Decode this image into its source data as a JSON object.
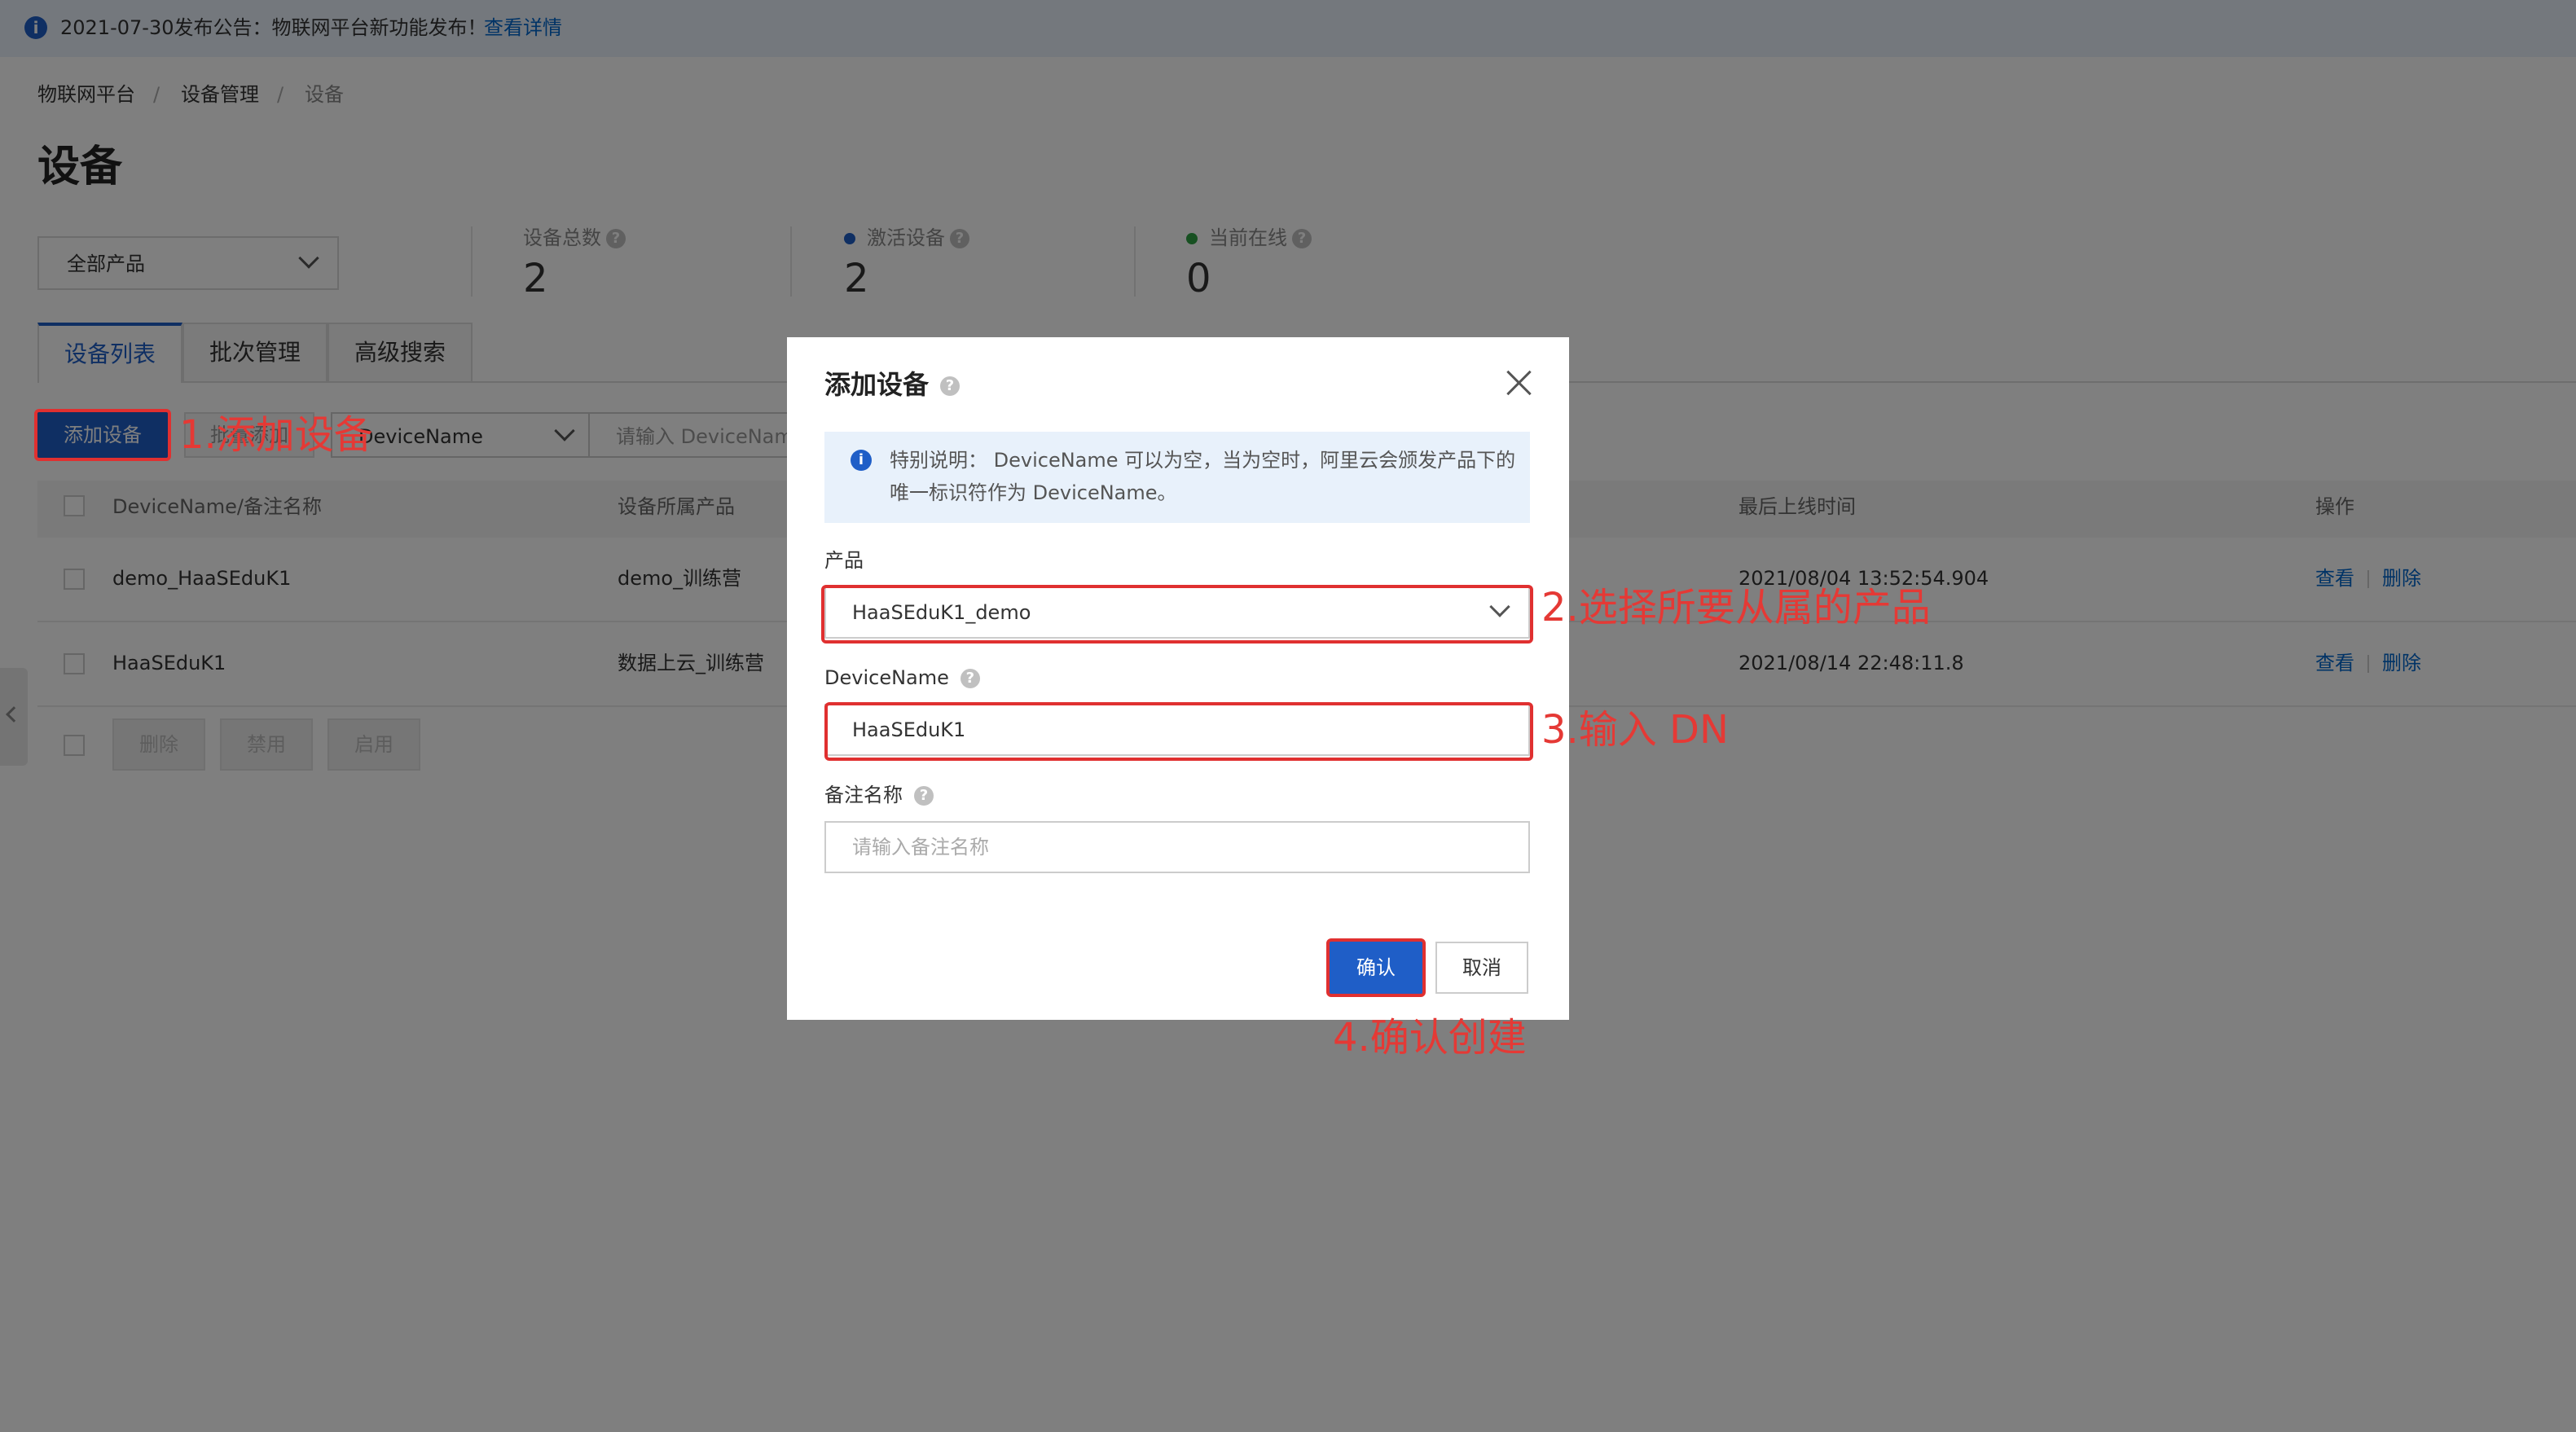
{
  "announcement": {
    "text": "2021-07-30发布公告：物联网平台新功能发布！",
    "link": "查看详情"
  },
  "breadcrumb": [
    "物联网平台",
    "设备管理",
    "设备"
  ],
  "breadcrumb_sep": "/",
  "page_title": "设备",
  "product_filter": "全部产品",
  "stats": [
    {
      "label": "设备总数",
      "value": "2"
    },
    {
      "label": "激活设备",
      "value": "2",
      "dot_color": "#1f5ec7"
    },
    {
      "label": "当前在线",
      "value": "0",
      "dot_color": "#2ea043"
    }
  ],
  "tabs": [
    "设备列表",
    "批次管理",
    "高级搜索"
  ],
  "toolbar": {
    "add_device": "添加设备",
    "batch_add": "批量添加",
    "search_field": "DeviceName",
    "search_placeholder": "请输入 DeviceName"
  },
  "table": {
    "headers": [
      "DeviceName/备注名称",
      "设备所属产品",
      "最后上线时间",
      "操作"
    ],
    "rows": [
      {
        "name": "demo_HaaSEduK1",
        "product": "demo_训练营",
        "last_online": "2021/08/04 13:52:54.904",
        "view": "查看",
        "delete": "删除"
      },
      {
        "name": "HaaSEduK1",
        "product": "数据上云_训练营",
        "last_online": "2021/08/14 22:48:11.8",
        "view": "查看",
        "delete": "删除"
      }
    ],
    "bulk_actions": [
      "删除",
      "禁用",
      "启用"
    ]
  },
  "modal": {
    "title": "添加设备",
    "notice_line1": "特别说明： DeviceName 可以为空，当为空时，阿里云会颁发产品下的",
    "notice_line2": "唯一标识符作为 DeviceName。",
    "product_label": "产品",
    "product_value": "HaaSEduK1_demo",
    "devicename_label": "DeviceName",
    "devicename_value": "HaaSEduK1",
    "remark_label": "备注名称",
    "remark_placeholder": "请输入备注名称",
    "confirm": "确认",
    "cancel": "取消"
  },
  "annotations": [
    "1.添加设备",
    "2.选择所要从属的产品",
    "3.输入 DN",
    "4.确认创建"
  ],
  "colors": {
    "primary": "#1f5ec7",
    "annotation_red": "#e53935",
    "link": "#0066cc"
  }
}
